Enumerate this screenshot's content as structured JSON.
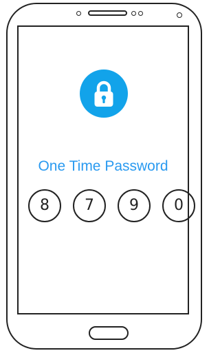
{
  "screen": {
    "title": "One Time Password",
    "lock_icon": "lock-icon",
    "accent_color": "#12a3ea",
    "title_color": "#2a9af0",
    "otp_digits": [
      "8",
      "7",
      "9",
      "0"
    ]
  }
}
